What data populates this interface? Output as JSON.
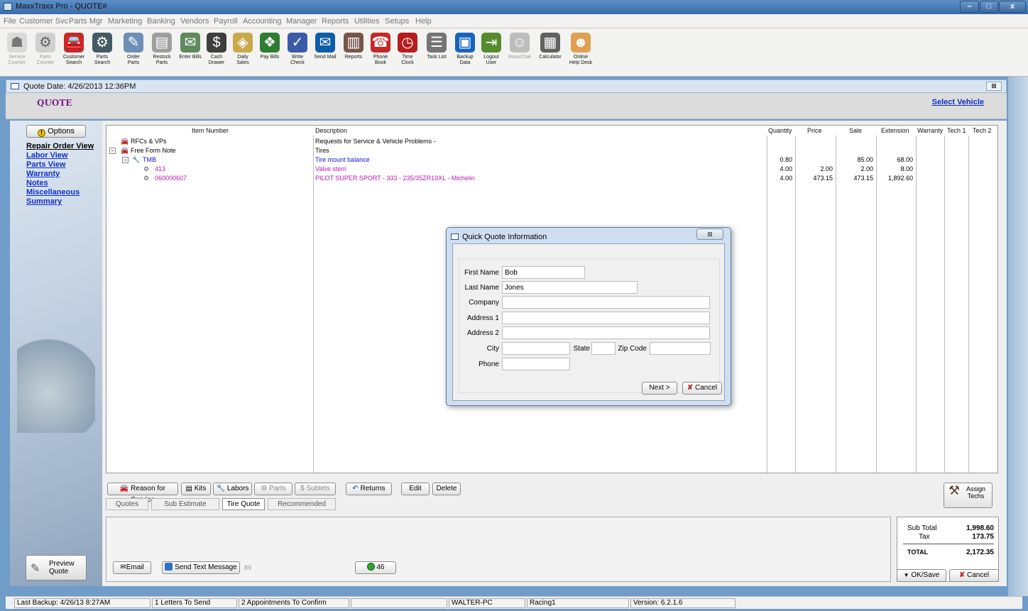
{
  "window": {
    "title": "MaxxTraxx Pro - QUOTE#",
    "min": "–",
    "max": "□",
    "close": "x"
  },
  "menu": [
    "File",
    "Customer Svc",
    "Parts Mgr",
    "Marketing",
    "Banking",
    "Vendors",
    "Payroll",
    "Accounting",
    "Manager",
    "Reports",
    "Utilities",
    "Setups",
    "Help"
  ],
  "toolbar": [
    {
      "l1": "Service",
      "l2": "Counter",
      "icon": "service-counter-icon",
      "disabled": true
    },
    {
      "l1": "Parts",
      "l2": "Counter",
      "icon": "parts-counter-icon",
      "disabled": true
    },
    {
      "l1": "Customer",
      "l2": "Search",
      "icon": "customer-search-icon"
    },
    {
      "l1": "Parts",
      "l2": "Search",
      "icon": "parts-search-icon"
    },
    {
      "l1": "Order",
      "l2": "Parts",
      "icon": "order-parts-icon"
    },
    {
      "l1": "Restock",
      "l2": "Parts",
      "icon": "restock-parts-icon"
    },
    {
      "l1": "Enter Bills",
      "l2": "",
      "icon": "enter-bills-icon"
    },
    {
      "l1": "Cash",
      "l2": "Drawer",
      "icon": "cash-drawer-icon"
    },
    {
      "l1": "Daily",
      "l2": "Sales",
      "icon": "daily-sales-icon"
    },
    {
      "l1": "Pay Bills",
      "l2": "",
      "icon": "pay-bills-icon"
    },
    {
      "l1": "Write",
      "l2": "Check",
      "icon": "write-check-icon"
    },
    {
      "l1": "Send Mail",
      "l2": "",
      "icon": "send-mail-icon"
    },
    {
      "l1": "Reports",
      "l2": "",
      "icon": "reports-icon"
    },
    {
      "l1": "Phone",
      "l2": "Book",
      "icon": "phone-book-icon"
    },
    {
      "l1": "Time",
      "l2": "Clock",
      "icon": "time-clock-icon"
    },
    {
      "l1": "Task List",
      "l2": "",
      "icon": "task-list-icon"
    },
    {
      "l1": "Backup",
      "l2": "Data",
      "icon": "backup-data-icon"
    },
    {
      "l1": "Logout",
      "l2": "User",
      "icon": "logout-user-icon"
    },
    {
      "l1": "MaxxChat",
      "l2": "",
      "icon": "maxxchat-icon",
      "disabled": true
    },
    {
      "l1": "Calculator",
      "l2": "",
      "icon": "calculator-icon"
    },
    {
      "l1": "Online",
      "l2": "Help Desk",
      "icon": "help-desk-icon"
    }
  ],
  "subwindow": {
    "title": "Quote Date: 4/26/2013 12:36PM",
    "close": "⊠"
  },
  "form": {
    "heading": "QUOTE",
    "select_vehicle": "Select Vehicle"
  },
  "left": {
    "options": "Options",
    "nav": [
      "Repair Order View",
      "Labor View",
      "Parts View",
      "Warranty",
      "Notes",
      "Miscellaneous",
      "Summary"
    ],
    "preview": "Preview Quote"
  },
  "grid": {
    "headers": {
      "item": "Item Number",
      "desc": "Description",
      "qty": "Quantity",
      "price": "Price",
      "sale": "Sale",
      "ext": "Extension",
      "warranty": "Warranty",
      "tech1": "Tech 1",
      "tech2": "Tech 2"
    },
    "rows": [
      {
        "item": "RFCs & VPs",
        "desc": "Requests for Service & Vehicle Problems -",
        "qty": "",
        "price": "",
        "sale": "",
        "ext": ""
      },
      {
        "item": "Free Form Note",
        "desc": "Tires",
        "qty": "",
        "price": "",
        "sale": "",
        "ext": ""
      },
      {
        "item": "TMB",
        "desc": "Tire mount balance",
        "qty": "0.80",
        "price": "",
        "sale": "85.00",
        "ext": "68.00"
      },
      {
        "item": "413",
        "desc": "Valve stem",
        "qty": "4.00",
        "price": "2.00",
        "sale": "2.00",
        "ext": "8.00"
      },
      {
        "item": "060000607",
        "desc": "PILOT SUPER SPORT - 333 - 235/35ZR19XL - Michelin",
        "qty": "4.00",
        "price": "473.15",
        "sale": "473.15",
        "ext": "1,892.60"
      }
    ]
  },
  "buttons": {
    "reason": "Reason for Service",
    "kits": "Kits",
    "labors": "Labors",
    "parts": "Parts",
    "sublets": "Sublets",
    "returns": "Returns",
    "edit": "Edit",
    "delete": "Delete",
    "assign": "Assign Techs"
  },
  "tabs": {
    "quotes": "Quotes",
    "sub_estimate": "Sub Estimate",
    "tire_quote": "Tire Quote",
    "recommended": "Recommended"
  },
  "bottom": {
    "email": "Email",
    "send_text": "Send Text Message",
    "count89": "89",
    "count46": "46"
  },
  "totals": {
    "sub_label": "Sub Total",
    "sub": "1,998.60",
    "tax_label": "Tax",
    "tax": "173.75",
    "total_label": "TOTAL",
    "total": "2,172.35",
    "ok": "OK/Save",
    "cancel": "Cancel"
  },
  "dialog": {
    "title": "Quick Quote Information",
    "close": "⊠",
    "first_label": "First Name",
    "first": "Bob",
    "last_label": "Last Name",
    "last": "Jones",
    "company_label": "Company",
    "company": "",
    "addr1_label": "Address 1",
    "addr1": "",
    "addr2_label": "Address 2",
    "addr2": "",
    "city_label": "City",
    "city": "",
    "state_label": "State",
    "state": "",
    "zip_label": "Zip Code",
    "zip": "",
    "phone_label": "Phone",
    "phone": "",
    "next": "Next >",
    "cancel": "Cancel"
  },
  "status": {
    "backup": "Last Backup: 4/26/13  8:27AM",
    "letters": "1 Letters To Send",
    "appts": "2 Appointments To Confirm",
    "blank": "",
    "pc": "WALTER-PC",
    "racing": "Racing1",
    "version": "Version: 6.2.1.6"
  },
  "colors": {
    "accent_purple": "#7a1f8c",
    "link_blue": "#1030c8",
    "item_blue": "#1212d8",
    "item_purple": "#b41ab4"
  }
}
